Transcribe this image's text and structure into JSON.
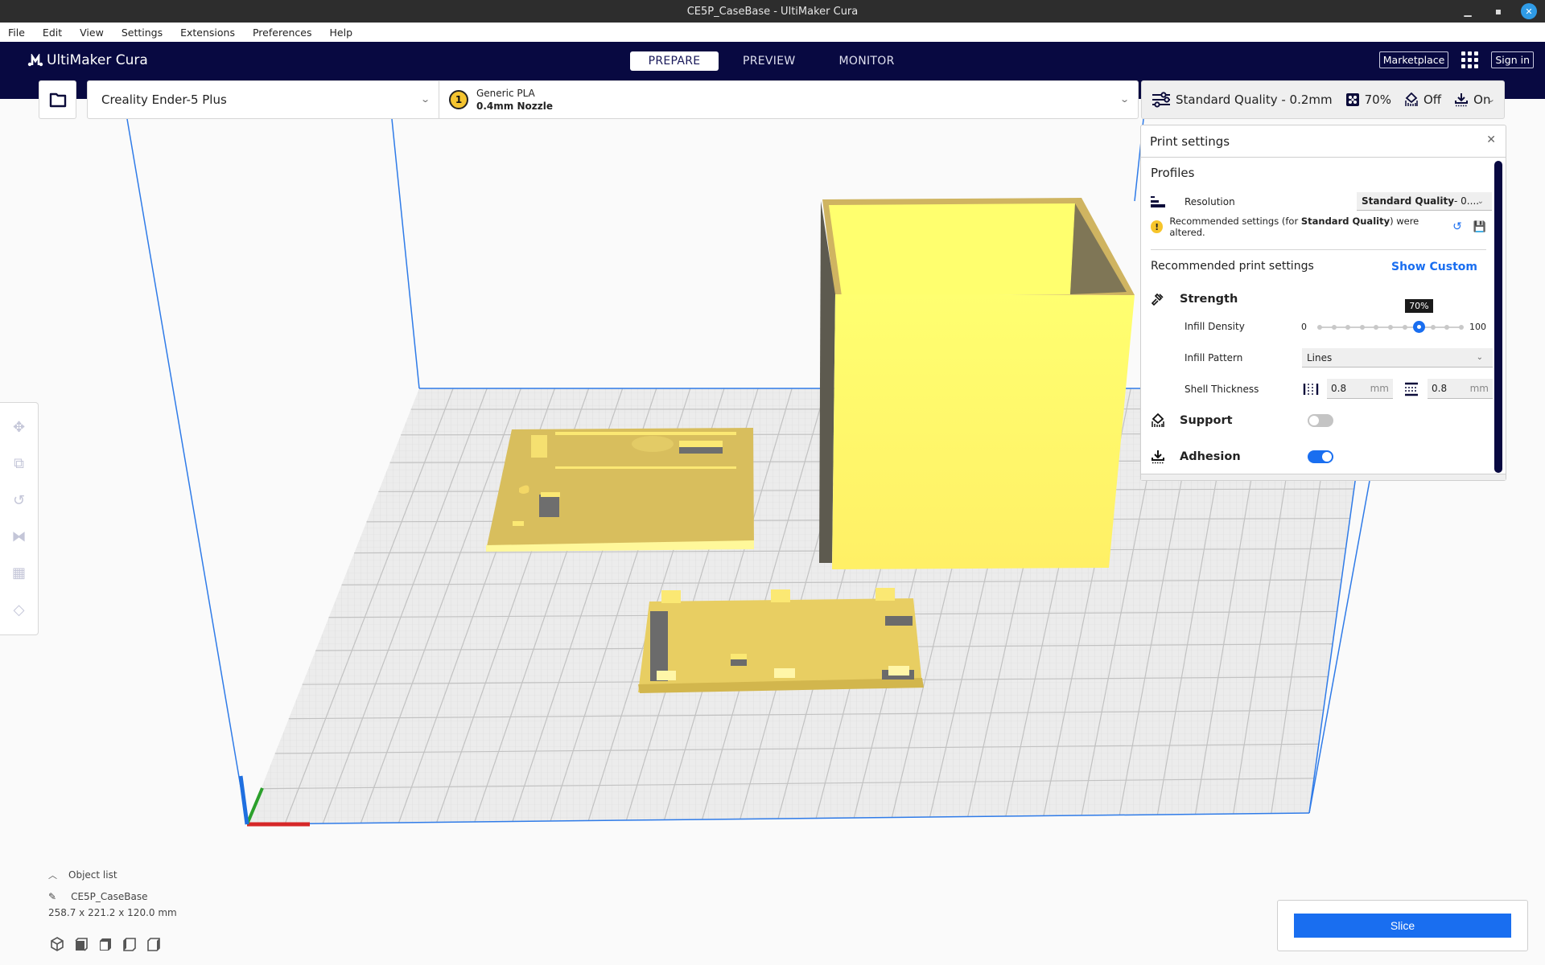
{
  "window": {
    "title": "CE5P_CaseBase - UltiMaker Cura",
    "controls": [
      "minimize",
      "maximize",
      "close"
    ]
  },
  "menu": [
    "File",
    "Edit",
    "View",
    "Settings",
    "Extensions",
    "Preferences",
    "Help"
  ],
  "header": {
    "logo": "UltiMaker Cura",
    "tabs": [
      {
        "label": "PREPARE",
        "active": true
      },
      {
        "label": "PREVIEW",
        "active": false
      },
      {
        "label": "MONITOR",
        "active": false
      }
    ],
    "marketplace": "Marketplace",
    "sign_in": "Sign in"
  },
  "stage": {
    "machine": "Creality Ender-5 Plus",
    "extruder_number": "1",
    "material": "Generic PLA",
    "nozzle": "0.4mm Nozzle",
    "profile_summary": "Standard Quality - 0.2mm",
    "infill_summary": "70%",
    "support_summary": "Off",
    "adhesion_summary": "On"
  },
  "print_settings": {
    "title": "Print settings",
    "profiles_heading": "Profiles",
    "resolution_label": "Resolution",
    "resolution_value_bold": "Standard Quality",
    "resolution_value_rest": " - 0....",
    "warning_prefix": "Recommended settings (for ",
    "warning_bold": "Standard Quality",
    "warning_suffix": ") were altered.",
    "recommended_heading": "Recommended print settings",
    "show_custom": "Show Custom",
    "strength_label": "Strength",
    "infill_density_label": "Infill Density",
    "infill_min": "0",
    "infill_max": "100",
    "infill_value_percent": 70,
    "infill_tooltip": "70%",
    "infill_pattern_label": "Infill Pattern",
    "infill_pattern_value": "Lines",
    "shell_thickness_label": "Shell Thickness",
    "wall_thickness": "0.8",
    "top_bottom_thickness": "0.8",
    "unit": "mm",
    "support_label": "Support",
    "support_enabled": false,
    "adhesion_label": "Adhesion",
    "adhesion_enabled": true
  },
  "object_list": {
    "heading": "Object list",
    "name": "CE5P_CaseBase",
    "dimensions": "258.7 x 221.2 x 120.0 mm"
  },
  "slice_button": "Slice",
  "colors": {
    "header_bg": "#080941",
    "accent_blue": "#196ef0",
    "model_yellow": "#fffb6b",
    "model_shade": "#d8c05e",
    "build_volume": "#2f7be8",
    "axis_x": "#d62728",
    "axis_y": "#2ca02c",
    "axis_z": "#1f6fe0"
  }
}
